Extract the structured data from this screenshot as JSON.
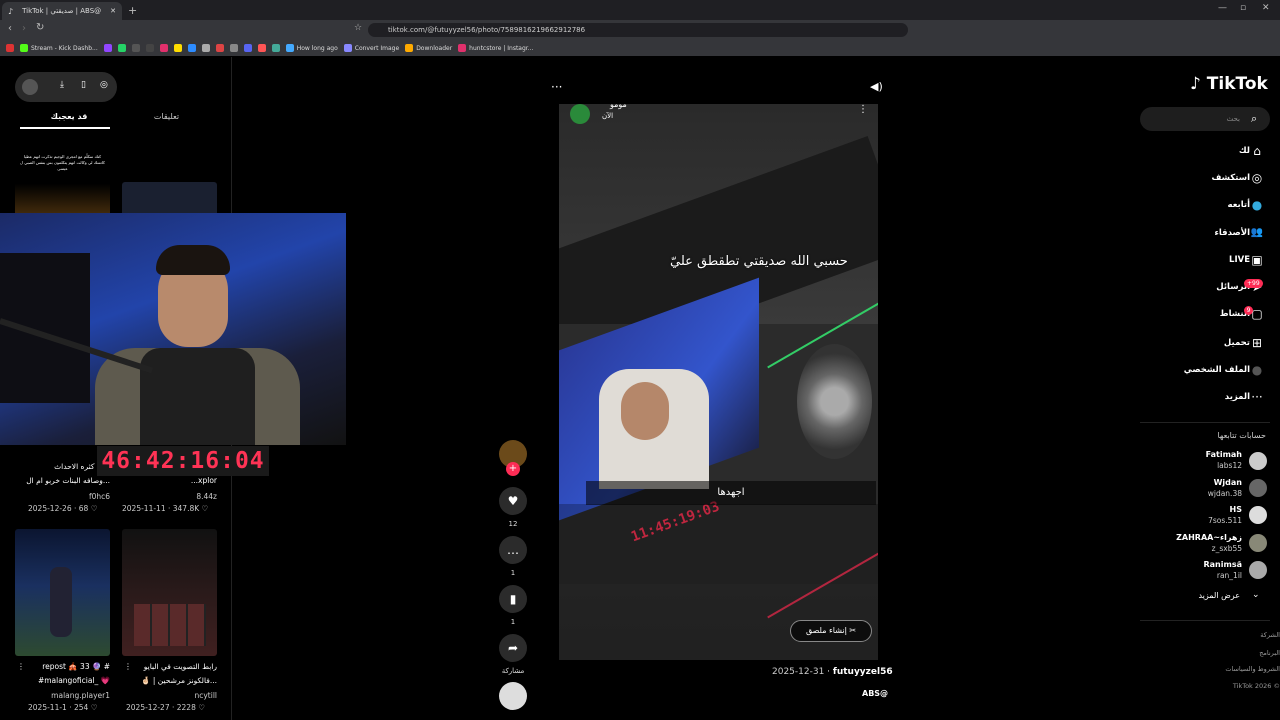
{
  "browser": {
    "tab_title": "TikTok | صديقتي | ABS@",
    "url": "tiktok.com/@futuyyzel56/photo/7589816219662912786",
    "bookmarks": [
      "Stream - Kick Dashb...",
      "How long ago",
      "Convert Image",
      "Downloader",
      "huntcstore | Instagr..."
    ]
  },
  "left_pane": {
    "tab_foryou": "قد يعجبك",
    "tab_comments": "تعليقات",
    "videos": [
      {
        "caption1": "بالله كثره الاحداث ",
        "caption2": "وصافه البنات خربو ام ال...",
        "user": "f0hc6",
        "date": "2025-12-26",
        "likes": "68"
      },
      {
        "caption1": "#ضبور######",
        "caption2": "...xplor",
        "user": "8.44z",
        "date": "2025-11-11",
        "likes": "347.8K"
      },
      {
        "caption1": "repost 🎪 33 🔮 #",
        "caption2": "#malangoficial_ 💗",
        "user": "malang.player1",
        "date": "2025-11-1",
        "likes": "254"
      },
      {
        "caption1": "رابط التصويت في البايو",
        "caption2": "🤞🏻 | فالكونز مرشحين...",
        "user": "ncytill",
        "date": "2025-12-27",
        "likes": "2228"
      }
    ],
    "thumb1_text": "كتك سكلّم مع امجرى الوجيم تذكرت انهم عطيا كاتسك لي وكالت انهم يتكلمون بس بنفس الصبي ل عيسى"
  },
  "timer": "46:42:16:04",
  "post": {
    "header_name": "مومو",
    "header_time": "الآن",
    "overlay_text_1": "حسبي الله صديقتي تطقطق عليّ",
    "overlay_text_2": "اجهدها",
    "sticker_button": "إنشاء ملصق",
    "username": "futuyyzel56",
    "date": "2025-12-31",
    "music": "ABS@",
    "inner_timer": "11:45:19:03"
  },
  "actions": {
    "likes": "12",
    "comments": "1",
    "saves": "1",
    "share": "مشاركة"
  },
  "sidebar": {
    "logo": "TikTok",
    "search_placeholder": "بحث",
    "nav": [
      {
        "label": "لك",
        "icon": "⌂"
      },
      {
        "label": "استكشف",
        "icon": "◎"
      },
      {
        "label": "أتابعه",
        "icon": "●"
      },
      {
        "label": "الأصدقاء",
        "icon": "👥"
      },
      {
        "label": "LIVE",
        "icon": "▣"
      },
      {
        "label": "الرسائل",
        "icon": "➤"
      },
      {
        "label": "النشاط",
        "icon": "▢"
      },
      {
        "label": "تحميل",
        "icon": "⊞"
      },
      {
        "label": "الملف الشخصي",
        "icon": "●"
      },
      {
        "label": "المزيد",
        "icon": "···"
      }
    ],
    "messages_badge": "+99",
    "activity_badge": "9",
    "following_title": "حسابات تتابعها",
    "following": [
      {
        "name": "Fatimah",
        "user": "labs12"
      },
      {
        "name": "Wjdan",
        "user": "wjdan.38"
      },
      {
        "name": "HS",
        "user": "7sos.511"
      },
      {
        "name": "ZAHRAA~زهراء",
        "user": "z_sxb55"
      },
      {
        "name": "Ranimsă",
        "user": "ran_1il"
      }
    ],
    "show_more": "عرض المزيد",
    "footer": [
      "الشركة",
      "البرنامج",
      "الشروط والسياسات",
      "TikTok 2026 ©"
    ]
  }
}
